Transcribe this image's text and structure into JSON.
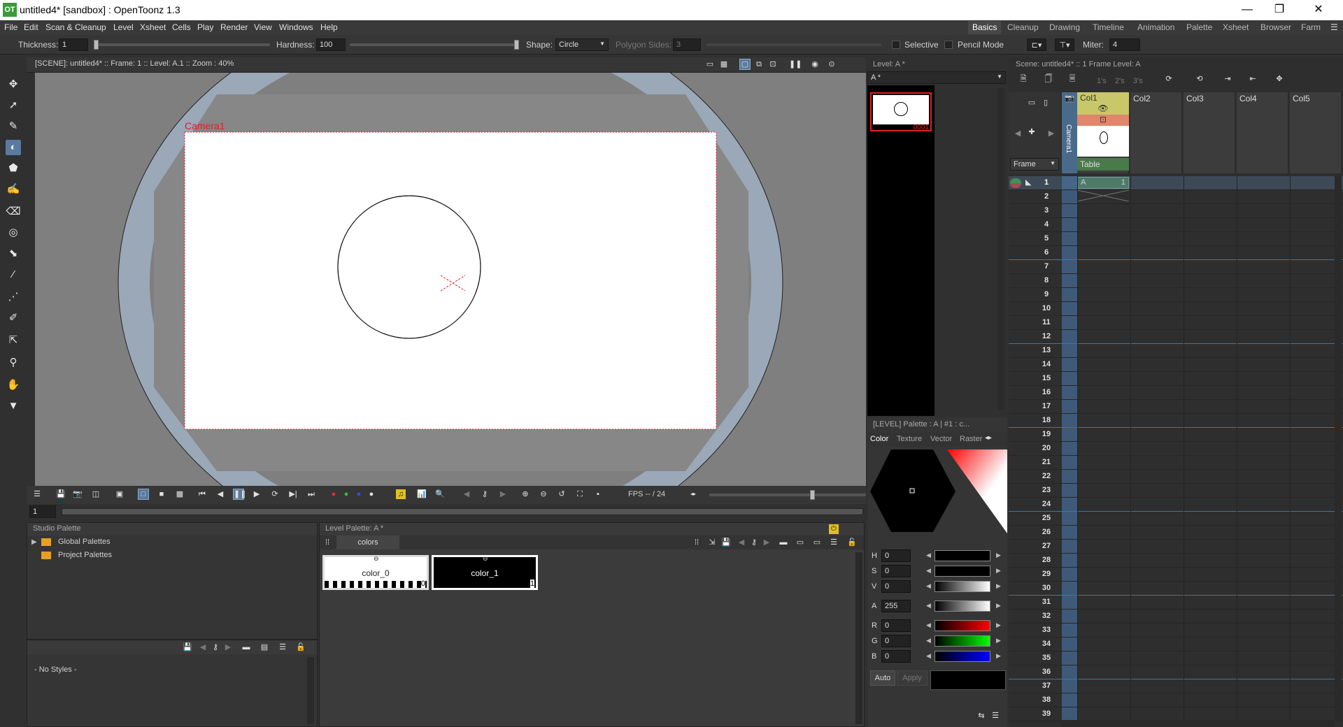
{
  "window": {
    "app_icon": "OT",
    "title": "untitled4* [sandbox] : OpenToonz 1.3",
    "minimize": "—",
    "maximize": "❐",
    "close": "✕"
  },
  "menu": [
    "File",
    "Edit",
    "Scan & Cleanup",
    "Level",
    "Xsheet",
    "Cells",
    "Play",
    "Render",
    "View",
    "Windows",
    "Help"
  ],
  "rooms": [
    "Basics",
    "Cleanup",
    "Drawing",
    "Timeline",
    "Animation",
    "Palette",
    "Xsheet",
    "Browser",
    "Farm"
  ],
  "tool_options": {
    "thickness_label": "Thickness:",
    "thickness": "1",
    "hardness_label": "Hardness:",
    "hardness": "100",
    "shape_label": "Shape:",
    "shape": "Circle",
    "polygon_label": "Polygon Sides:",
    "polygon_sides": "3",
    "selective": "Selective",
    "pencil_mode": "Pencil Mode",
    "miter_label": "Miter:",
    "miter": "4"
  },
  "viewer": {
    "header": "[SCENE]: untitled4*  ::  Frame: 1  ::  Level: A.1  ::  Zoom : 40%",
    "camera_label": "Camera1",
    "fps_label": "FPS -- / 24",
    "frame_field": "1"
  },
  "level_strip": {
    "header": "Level:  A *",
    "level_select": "A *",
    "frame_label": "0001"
  },
  "studio_palette": {
    "title": "Studio Palette",
    "items": [
      "Global Palettes",
      "Project Palettes"
    ],
    "no_styles": "- No Styles -"
  },
  "level_palette": {
    "title": "Level Palette: A *",
    "tab": "colors",
    "chips": [
      {
        "name": "color_0",
        "index": "0"
      },
      {
        "name": "color_1",
        "index": "1"
      }
    ]
  },
  "style_editor": {
    "header": "[LEVEL]  Palette : A | #1 : c...",
    "tabs": [
      "Color",
      "Texture",
      "Vector",
      "Raster"
    ],
    "channels": [
      {
        "key": "H",
        "value": "0"
      },
      {
        "key": "S",
        "value": "0"
      },
      {
        "key": "V",
        "value": "0"
      },
      {
        "key": "A",
        "value": "255"
      },
      {
        "key": "R",
        "value": "0"
      },
      {
        "key": "G",
        "value": "0"
      },
      {
        "key": "B",
        "value": "0"
      }
    ],
    "auto": "Auto",
    "apply": "Apply"
  },
  "xsheet": {
    "header": "Scene: untitled4*   ::   1 Frame  Level: A",
    "step_labels": [
      "1's",
      "2's",
      "3's"
    ],
    "frame_dropdown": "Frame",
    "camera_column": "Camera1",
    "table_label": "Table",
    "columns": [
      "Col1",
      "Col2",
      "Col3",
      "Col4",
      "Col5"
    ],
    "cell_level": "A",
    "cell_frame": "1",
    "rows": [
      "1",
      "2",
      "3",
      "4",
      "5",
      "6",
      "7",
      "8",
      "9",
      "10",
      "11",
      "12",
      "13",
      "14",
      "15",
      "16",
      "17",
      "18",
      "19",
      "20",
      "21",
      "22",
      "23",
      "24",
      "25",
      "26",
      "27",
      "28",
      "29",
      "30",
      "31",
      "32",
      "33",
      "34",
      "35",
      "36",
      "37",
      "38",
      "39"
    ]
  },
  "colors": {
    "accent": "#5a7aa0",
    "camera_red": "#e0202a",
    "col1_header": "#c8c86a",
    "cell_green": "#4a7a4a",
    "xsheet_blue": "#4a6a8a"
  }
}
